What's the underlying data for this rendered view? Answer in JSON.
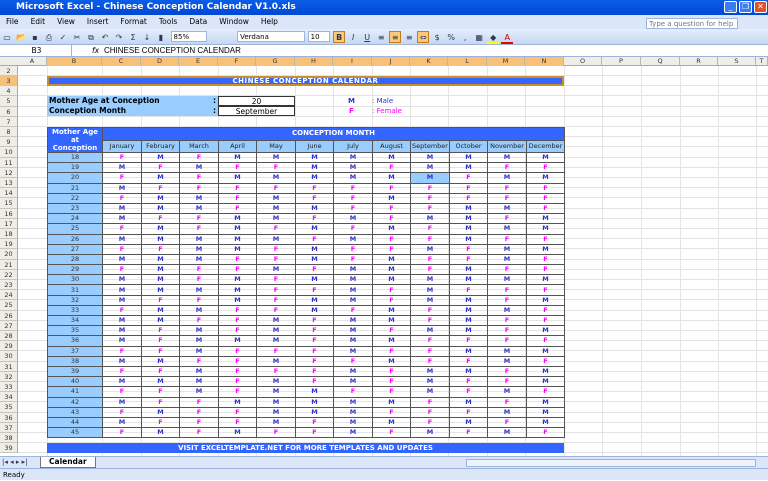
{
  "window": {
    "title": "Microsoft Excel - Chinese Conception Calendar V1.0.xls"
  },
  "menu": [
    "File",
    "Edit",
    "View",
    "Insert",
    "Format",
    "Tools",
    "Data",
    "Window",
    "Help"
  ],
  "help_placeholder": "Type a question for help",
  "toolbar": {
    "zoom": "85%",
    "font": "Verdana",
    "size": "10"
  },
  "formula": {
    "cell_ref": "B3",
    "fx": "fx",
    "content": "CHINESE CONCEPTION CALENDAR"
  },
  "columns": [
    "A",
    "B",
    "C",
    "D",
    "E",
    "F",
    "G",
    "H",
    "I",
    "J",
    "K",
    "L",
    "M",
    "N",
    "O",
    "P",
    "Q",
    "R",
    "S",
    "T"
  ],
  "rows": [
    "2",
    "3",
    "4",
    "5",
    "6",
    "7",
    "8",
    "9",
    "10",
    "11",
    "12",
    "13",
    "14",
    "15",
    "16",
    "17",
    "18",
    "19",
    "20",
    "21",
    "22",
    "23",
    "24",
    "25",
    "26",
    "27",
    "28",
    "29",
    "30",
    "31",
    "32",
    "33",
    "34",
    "35",
    "36",
    "37",
    "38",
    "39"
  ],
  "sheet": {
    "title": "CHINESE CONCEPTION CALENDAR",
    "age_label": "Mother Age at Conception",
    "month_label": "Conception Month",
    "colon": ":",
    "age_value": "20",
    "month_value": "September",
    "legend": [
      {
        "code": "M",
        "text": ": Male"
      },
      {
        "code": "F",
        "text": ": Female"
      }
    ],
    "age_header": "Mother Age at Conception",
    "month_header": "CONCEPTION MONTH",
    "months": [
      "January",
      "February",
      "March",
      "April",
      "May",
      "June",
      "July",
      "August",
      "September",
      "October",
      "November",
      "December"
    ],
    "ages": [
      "18",
      "19",
      "20",
      "21",
      "22",
      "23",
      "24",
      "25",
      "26",
      "27",
      "28",
      "29",
      "30",
      "31",
      "32",
      "33",
      "34",
      "35",
      "36",
      "37",
      "38",
      "39",
      "40",
      "41",
      "42",
      "43",
      "44",
      "45"
    ],
    "grid": [
      "FMFMMMMMMMMM",
      "MFMFFMMFMMFF",
      "FMFMMMMMMFMM",
      "MFFFFFFFFFFF",
      "FMMFMFFMFFFF",
      "MMMFMMFFFMMF",
      "MFFMMFMFMMFM",
      "FMFMFMFMFMMM",
      "MMMMMFMFFMFF",
      "FFMMFMFFMFMM",
      "MMMFFMFMFFMF",
      "FMFFMFMMFMFF",
      "MMFMFMMMMMMM",
      "MMMMFFMFMFFF",
      "MFFMFMMFMMFM",
      "FMMFFMFMFMMF",
      "MMFFMFMMFMFF",
      "MFMFMFMFMMFM",
      "MFMMMFMMFFFF",
      "FFMFFFMFFMMM",
      "MMFFMFFMFFMF",
      "FFMFFFMFMMFM",
      "MMMFMFMFMFFM",
      "FFMFMMFFMFMF",
      "MFFMMMMMFMFM",
      "FMFFMMMFFFMM",
      "MFFFMFMMFMFM",
      "FMFMFFMFMFMF"
    ],
    "selected_age_index": 2,
    "selected_month_index": 8,
    "visit": "VISIT EXCELTEMPLATE.NET FOR MORE TEMPLATES AND UPDATES"
  },
  "tab": "Calendar",
  "status": "Ready",
  "colors": {
    "banner": "#3366ff",
    "header": "#99ccff",
    "male": "#3333cc",
    "female": "#ff00ff"
  }
}
